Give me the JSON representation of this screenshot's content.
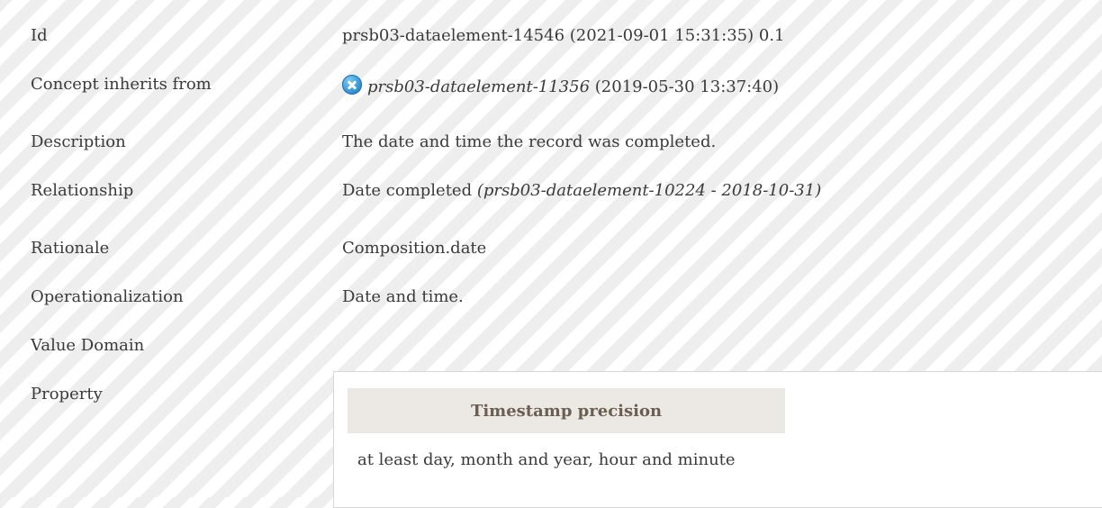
{
  "rows": {
    "id": {
      "label": "Id",
      "value": "prsb03-dataelement-14546 (2021-09-01 15:31:35) 0.1"
    },
    "concept": {
      "label": "Concept inherits from",
      "icon": "deprecated-x-icon",
      "link": "prsb03-dataelement-11356",
      "suffix": " (2019-05-30 13:37:40)"
    },
    "description": {
      "label": "Description",
      "value": "The date and time the record was completed."
    },
    "relationship": {
      "label": "Relationship",
      "value": "Date completed ",
      "ref": "(prsb03-dataelement-10224 - 2018-10-31)"
    },
    "rationale": {
      "label": "Rationale",
      "value": "Composition.date"
    },
    "operationalization": {
      "label": "Operationalization",
      "value": "Date and time."
    },
    "value_domain": {
      "label": "Value Domain"
    },
    "property": {
      "label": "Property"
    }
  },
  "property_panel": {
    "header": "Timestamp precision",
    "value": "at least day, month and year, hour and minute"
  },
  "colors": {
    "text": "#3a3a3a",
    "stripe": "#eeeeee",
    "panel_header_bg": "#ece8e3",
    "panel_header_text": "#6b5f54",
    "icon": "#3a9ad9"
  }
}
